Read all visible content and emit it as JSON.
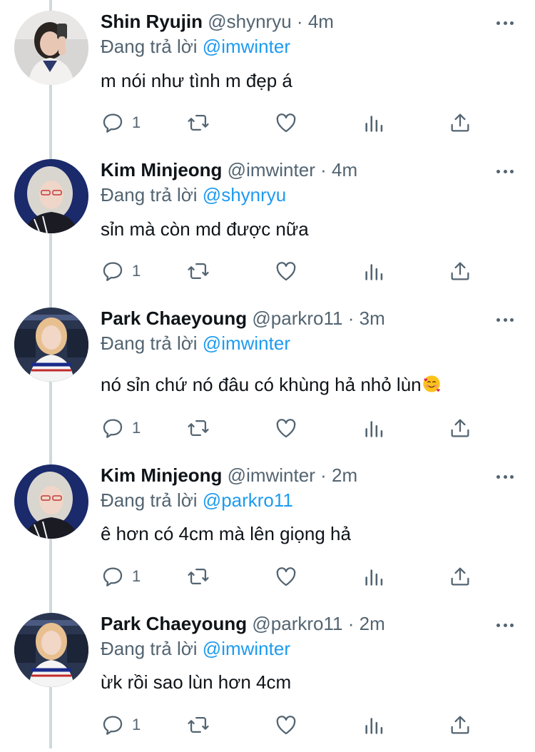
{
  "replying_prefix": "Đang trả lời",
  "tweets": [
    {
      "name": "Shin Ryujin",
      "handle": "@shynryu",
      "time": "4m",
      "replying_to": "@imwinter",
      "text": "m nói như tình m đẹp á",
      "reply_count": "1",
      "avatar": "avatar-ryujin"
    },
    {
      "name": "Kim Minjeong",
      "handle": "@imwinter",
      "time": "4m",
      "replying_to": "@shynryu",
      "text": "sỉn mà còn md được nữa",
      "reply_count": "1",
      "avatar": "avatar-minjeong"
    },
    {
      "name": "Park Chaeyoung",
      "handle": "@parkro11",
      "time": "3m",
      "replying_to": "@imwinter",
      "text": "nó sỉn chứ nó đâu có khùng hả nhỏ lùn",
      "emoji": "smiling-face-with-hearts",
      "reply_count": "1",
      "avatar": "avatar-chaeyoung"
    },
    {
      "name": "Kim Minjeong",
      "handle": "@imwinter",
      "time": "2m",
      "replying_to": "@parkro11",
      "text": "ê hơn có 4cm mà lên giọng hả",
      "reply_count": "1",
      "avatar": "avatar-minjeong"
    },
    {
      "name": "Park Chaeyoung",
      "handle": "@parkro11",
      "time": "2m",
      "replying_to": "@imwinter",
      "text": "ừk rồi sao lùn hơn 4cm",
      "reply_count": "1",
      "avatar": "avatar-chaeyoung"
    }
  ],
  "colors": {
    "link": "#1d9bf0",
    "secondary": "#536471",
    "thread_line": "#cfd9de"
  }
}
